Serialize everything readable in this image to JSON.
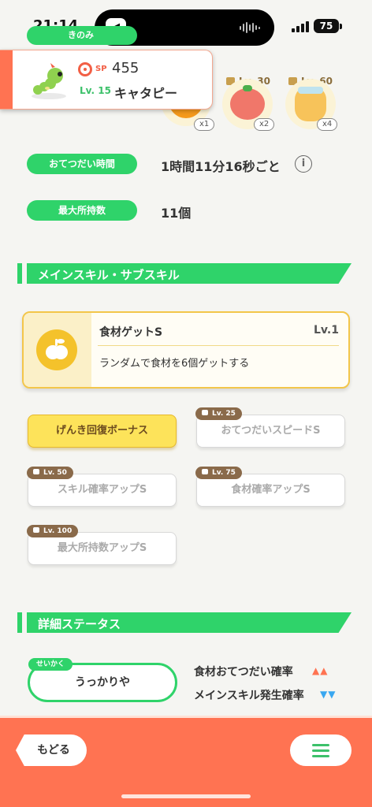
{
  "status_bar": {
    "time": "21:14",
    "battery": "75",
    "icons": [
      "speaker-icon",
      "audio-wave-icon",
      "signal-icon",
      "battery-icon"
    ]
  },
  "header": {
    "partial_label": "きのみ",
    "pokemon": {
      "sp_label": "SP",
      "sp_value": "455",
      "level": "Lv. 15",
      "name": "キャタピー"
    }
  },
  "ingredients": [
    {
      "unlock": "",
      "qty": "x1",
      "icon": "orange-ingredient-icon"
    },
    {
      "unlock": "Lv. 30",
      "qty": "x2",
      "icon": "tomato-ingredient-icon"
    },
    {
      "unlock": "Lv. 60",
      "qty": "x4",
      "icon": "honey-jar-ingredient-icon"
    }
  ],
  "info_rows": [
    {
      "label": "おてつだい時間",
      "value": "1時間11分16秒ごと"
    },
    {
      "label": "最大所持数",
      "value": "11個"
    }
  ],
  "sections": {
    "skills_title": "メインスキル・サブスキル",
    "details_title": "詳細ステータス"
  },
  "main_skill": {
    "name": "食材ゲットS",
    "level": "Lv.1",
    "description": "ランダムで食材を6個ゲットする"
  },
  "sub_skills": [
    {
      "label": "げんき回復ボーナス",
      "unlock": "",
      "active": true
    },
    {
      "label": "おてつだいスピードS",
      "unlock": "Lv. 25",
      "active": false
    },
    {
      "label": "スキル確率アップS",
      "unlock": "Lv. 50",
      "active": false
    },
    {
      "label": "食材確率アップS",
      "unlock": "Lv. 75",
      "active": false
    },
    {
      "label": "最大所持数アップS",
      "unlock": "Lv. 100",
      "active": false
    }
  ],
  "nature": {
    "tag": "せいかく",
    "value": "うっかりや",
    "effects": [
      {
        "label": "食材おてつだい確率",
        "arrows": "▲▲",
        "color": "#ff7352"
      },
      {
        "label": "メインスキル発生確率",
        "arrows": "▼▼",
        "color": "#3aa7f0"
      }
    ]
  },
  "bottom_bar": {
    "back_label": "もどる",
    "menu_icon": "hamburger-menu-icon"
  },
  "colors": {
    "accent_green": "#2fd36a",
    "accent_orange": "#ff7352",
    "skill_yellow": "#fde35a"
  }
}
